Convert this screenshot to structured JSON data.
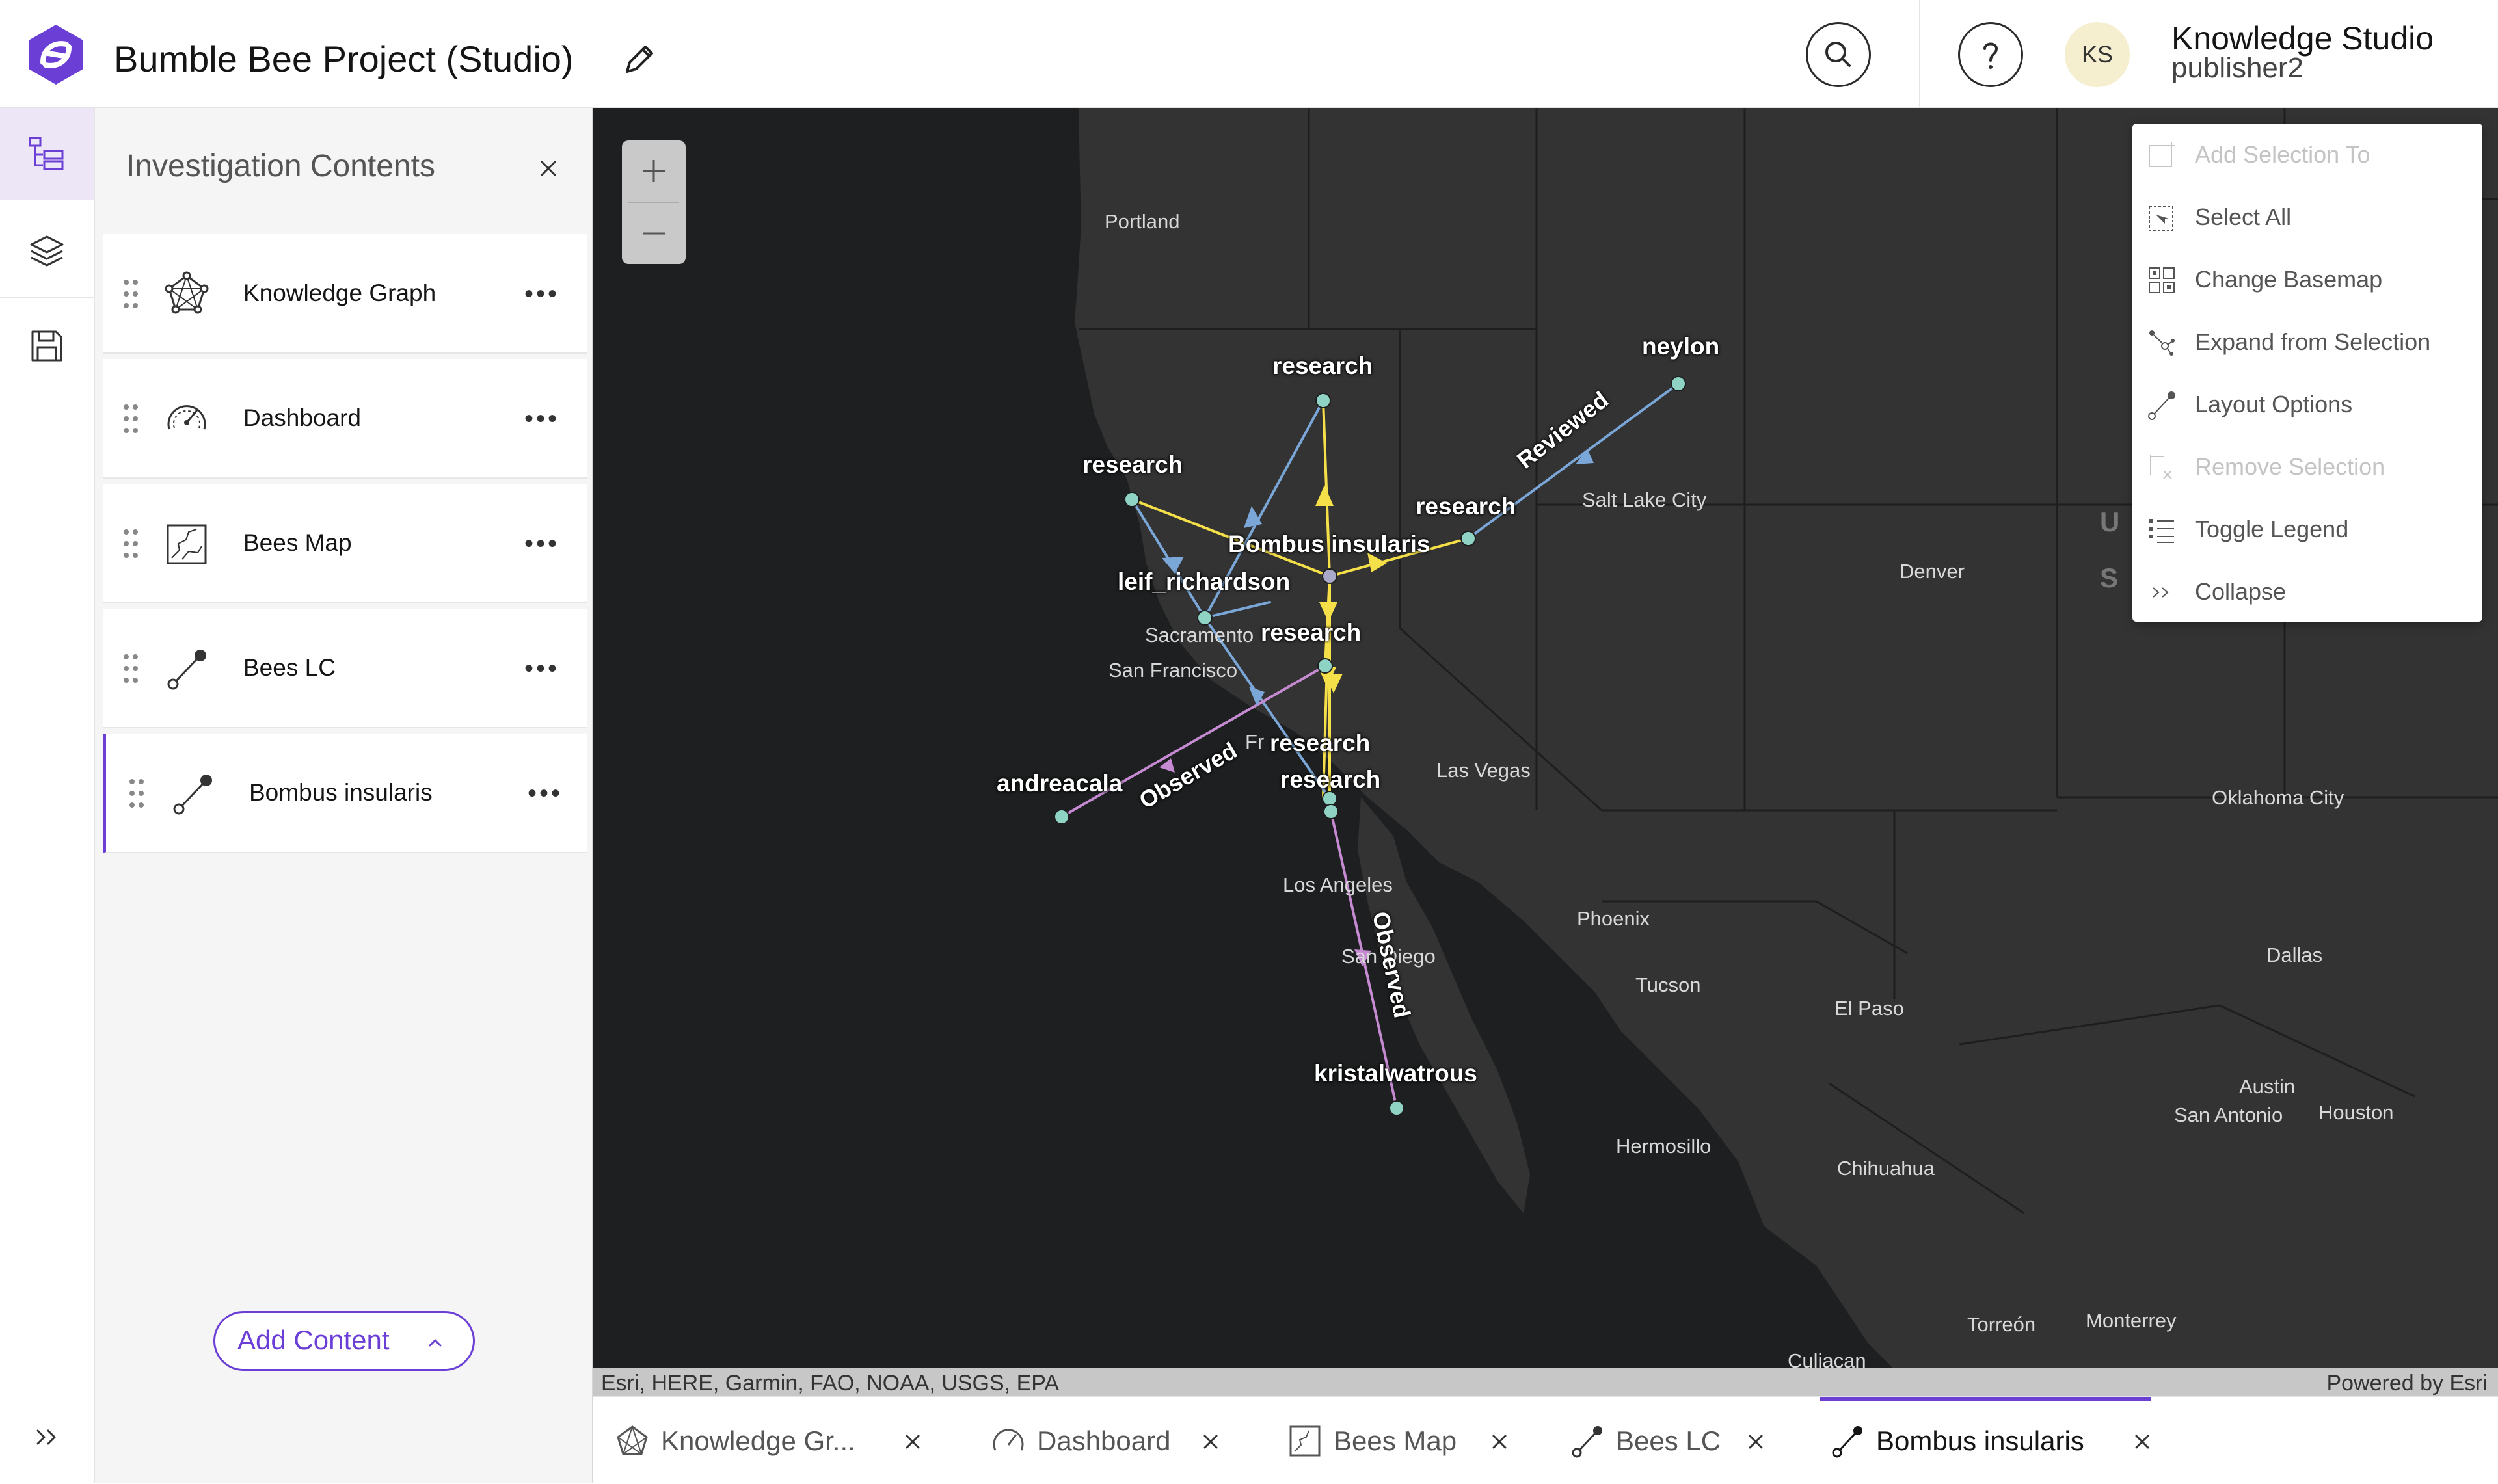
{
  "app": {
    "title": "Bumble Bee Project (Studio)",
    "brand_color": "#6b3ed6"
  },
  "header": {
    "search_icon": "search-icon",
    "help_icon": "help-icon",
    "avatar_initials": "KS",
    "user_name": "Knowledge Studio",
    "user_id": "publisher2"
  },
  "rail": {
    "items": [
      "contents-icon",
      "layers-icon",
      "save-icon"
    ],
    "expand_icon": "chevrons-right-icon"
  },
  "panel": {
    "title": "Investigation Contents",
    "items": [
      {
        "label": "Knowledge Graph",
        "icon": "knowledge-graph-icon"
      },
      {
        "label": "Dashboard",
        "icon": "dashboard-icon"
      },
      {
        "label": "Bees Map",
        "icon": "map-icon"
      },
      {
        "label": "Bees LC",
        "icon": "link-chart-icon"
      },
      {
        "label": "Bombus insularis",
        "icon": "link-chart-icon",
        "active": true
      }
    ],
    "more_label": "•••",
    "add_content_label": "Add Content"
  },
  "map": {
    "zoom_in_icon": "plus-icon",
    "zoom_out_icon": "minus-icon",
    "attribution": "Esri, HERE, Garmin, FAO, NOAA, USGS, EPA",
    "powered_by": "Powered by Esri",
    "cities": [
      "Portland",
      "Salt Lake City",
      "Denver",
      "Sacramento",
      "San Francisco",
      "Las Vegas",
      "Los Angeles",
      "San Diego",
      "Phoenix",
      "Tucson",
      "El Paso",
      "Oklahoma City",
      "Dallas",
      "Austin",
      "San Antonio",
      "Houston",
      "Hermosillo",
      "Chihuahua",
      "Torreón",
      "Monterrey",
      "Culiacan",
      "U",
      "S",
      "Fr"
    ],
    "nodes": [
      "research",
      "neylon",
      "research",
      "research",
      "Bombus insularis",
      "leif_richardson",
      "research",
      "research",
      "research",
      "andreacala",
      "kristalwatrous"
    ],
    "edge_labels": [
      "Reviewed",
      "Observed",
      "Observed"
    ],
    "colors": {
      "land": "#333333",
      "water": "#1d1f20",
      "yellow_edge": "#f5e04a",
      "blue_edge": "#7aa6d8",
      "purple_edge": "#c58ad1",
      "node_fill": "#8fd3c4"
    }
  },
  "menu": {
    "items": [
      {
        "label": "Add Selection To",
        "icon": "add-selection-icon",
        "disabled": true
      },
      {
        "label": "Select All",
        "icon": "select-all-icon",
        "disabled": false
      },
      {
        "label": "Change Basemap",
        "icon": "basemap-icon",
        "disabled": false
      },
      {
        "label": "Expand from Selection",
        "icon": "expand-icon",
        "disabled": false
      },
      {
        "label": "Layout Options",
        "icon": "layout-icon",
        "disabled": false
      },
      {
        "label": "Remove Selection",
        "icon": "remove-selection-icon",
        "disabled": true
      },
      {
        "label": "Toggle Legend",
        "icon": "legend-icon",
        "disabled": false
      },
      {
        "label": "Collapse",
        "icon": "chevrons-right-icon",
        "disabled": false
      }
    ]
  },
  "tabs": [
    {
      "label": "Knowledge Gr...",
      "icon": "knowledge-graph-icon"
    },
    {
      "label": "Dashboard",
      "icon": "dashboard-icon"
    },
    {
      "label": "Bees Map",
      "icon": "map-icon"
    },
    {
      "label": "Bees LC",
      "icon": "link-chart-icon"
    },
    {
      "label": "Bombus insularis",
      "icon": "link-chart-icon",
      "active": true
    }
  ]
}
